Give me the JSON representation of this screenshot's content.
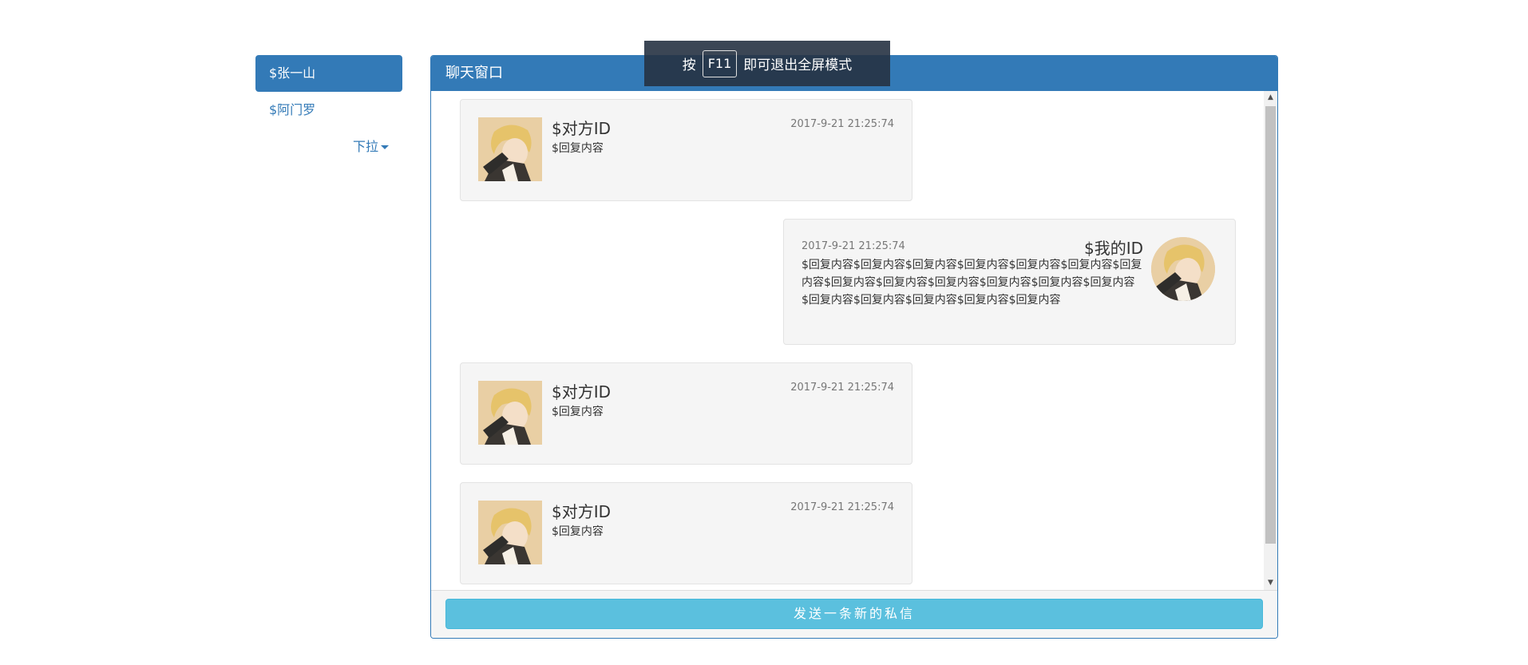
{
  "sidebar": {
    "items": [
      {
        "label": "$张一山",
        "active": true
      },
      {
        "label": "$阿门罗",
        "active": false
      }
    ],
    "dropdown_label": "下拉"
  },
  "panel": {
    "title": "聊天窗口"
  },
  "messages": [
    {
      "side": "left",
      "name": "$对方ID",
      "time": "2017-9-21 21:25:74",
      "text": "$回复内容"
    },
    {
      "side": "right",
      "name": "$我的ID",
      "time": "2017-9-21 21:25:74",
      "text": "$回复内容$回复内容$回复内容$回复内容$回复内容$回复内容$回复内容$回复内容$回复内容$回复内容$回复内容$回复内容$回复内容$回复内容$回复内容$回复内容$回复内容$回复内容"
    },
    {
      "side": "left",
      "name": "$对方ID",
      "time": "2017-9-21 21:25:74",
      "text": "$回复内容"
    },
    {
      "side": "left",
      "name": "$对方ID",
      "time": "2017-9-21 21:25:74",
      "text": "$回复内容"
    }
  ],
  "footer": {
    "send_label": "发送一条新的私信"
  },
  "fullscreen_hint": {
    "prefix": "按",
    "key": "F11",
    "suffix": "即可退出全屏模式"
  },
  "colors": {
    "primary": "#337ab7",
    "info": "#5bc0de",
    "message_bg": "#f5f5f5"
  }
}
